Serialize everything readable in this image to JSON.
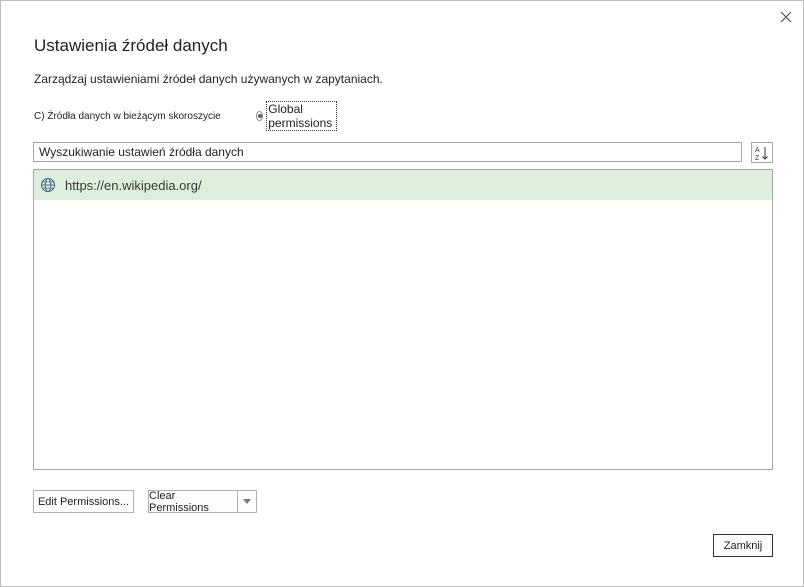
{
  "dialog": {
    "title": "Ustawienia źródeł danych",
    "subtitle": "Zarządzaj ustawieniami źródeł danych używanych w zapytaniach."
  },
  "scope": {
    "option_current": "C) Źródła danych w bieżącym skoroszycie",
    "option_global": "Global permissions",
    "selected": "global"
  },
  "search": {
    "placeholder": "Wyszukiwanie ustawień źródła danych",
    "value": ""
  },
  "sort": {
    "icon": "sort-az-icon"
  },
  "sources": [
    {
      "url": "https://en.wikipedia.org/",
      "icon": "globe-icon",
      "selected": true
    }
  ],
  "buttons": {
    "edit_permissions": "Edit Permissions...",
    "clear_permissions": "Clear Permissions",
    "close": "Zamknij"
  },
  "colors": {
    "selected_row": "#ddeedd",
    "border": "#a6a6a6"
  }
}
